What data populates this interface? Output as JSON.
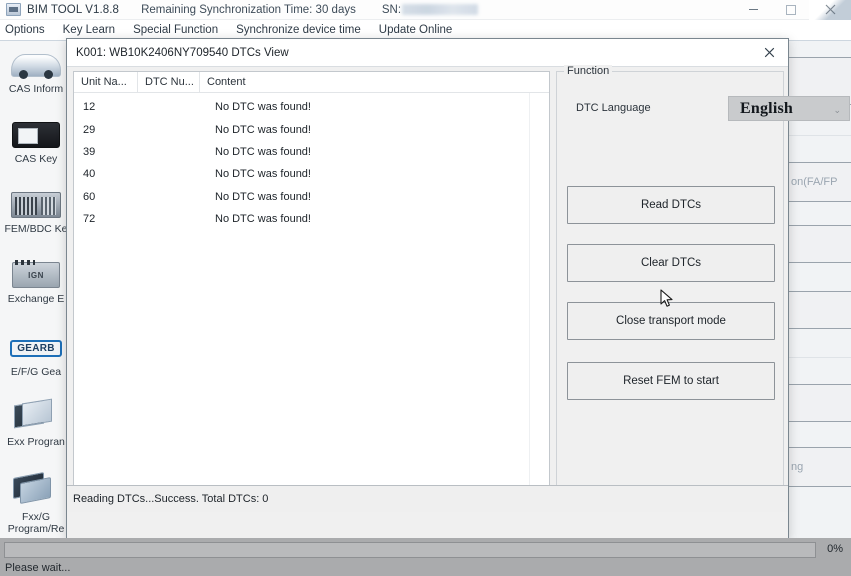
{
  "window": {
    "title": "BIM TOOL V1.8.8",
    "sync_time": "Remaining Synchronization Time: 30 days",
    "sn_label": "SN:",
    "sn_value_redacted": "",
    "controls": {
      "minimize": "–",
      "maximize": "□",
      "close": "✕"
    }
  },
  "menubar": {
    "items": [
      {
        "label": "Options"
      },
      {
        "label": "Key Learn"
      },
      {
        "label": "Special Function"
      },
      {
        "label": "Synchronize device time"
      },
      {
        "label": "Update Online"
      }
    ]
  },
  "sidebar": {
    "items": [
      {
        "label": "CAS Inform",
        "icon": "car-icon"
      },
      {
        "label": "CAS Key ",
        "icon": "cas-key-icon"
      },
      {
        "label": "FEM/BDC Ke",
        "icon": "fem-bdc-icon"
      },
      {
        "label": "Exchange E",
        "icon": "ignition-module-icon"
      },
      {
        "label": "E/F/G Gea",
        "icon": "gearbox-icon",
        "icon_text": "GEARB"
      },
      {
        "label": "Exx Progran",
        "icon": "documents-icon"
      },
      {
        "label": "Fxx/G\nProgram/Re",
        "icon": "cards-icon"
      }
    ]
  },
  "background_panel": {
    "buttons": [
      {
        "label": ""
      },
      {
        "label": "on(FA/FP"
      },
      {
        "label": ""
      },
      {
        "label": ""
      },
      {
        "label": ""
      },
      {
        "label": "ng"
      }
    ]
  },
  "dialog": {
    "title": "K001: WB10K2406NY709540 DTCs View",
    "close_label": "✕",
    "table": {
      "columns": [
        "Unit Na...",
        "DTC Nu...",
        "Content"
      ],
      "rows": [
        {
          "unit": "12",
          "dtc": "",
          "content": "No DTC was found!"
        },
        {
          "unit": "29",
          "dtc": "",
          "content": "No DTC was found!"
        },
        {
          "unit": "39",
          "dtc": "",
          "content": "No DTC was found!"
        },
        {
          "unit": "40",
          "dtc": "",
          "content": "No DTC was found!"
        },
        {
          "unit": "60",
          "dtc": "",
          "content": "No DTC was found!"
        },
        {
          "unit": "72",
          "dtc": "",
          "content": "No DTC was found!"
        }
      ]
    },
    "function_group": {
      "legend": "Function",
      "language_label": "DTC Language",
      "language_value": "English",
      "language_arrow": "⌄",
      "buttons": [
        {
          "label": "Read DTCs"
        },
        {
          "label": "Clear DTCs"
        },
        {
          "label": "Close transport mode"
        },
        {
          "label": "Reset FEM to start"
        }
      ]
    },
    "status": "Reading DTCs...Success.  Total DTCs: 0"
  },
  "bottom": {
    "progress_percent": "0%",
    "progress_value": 0,
    "wait_text": "Please wait..."
  }
}
